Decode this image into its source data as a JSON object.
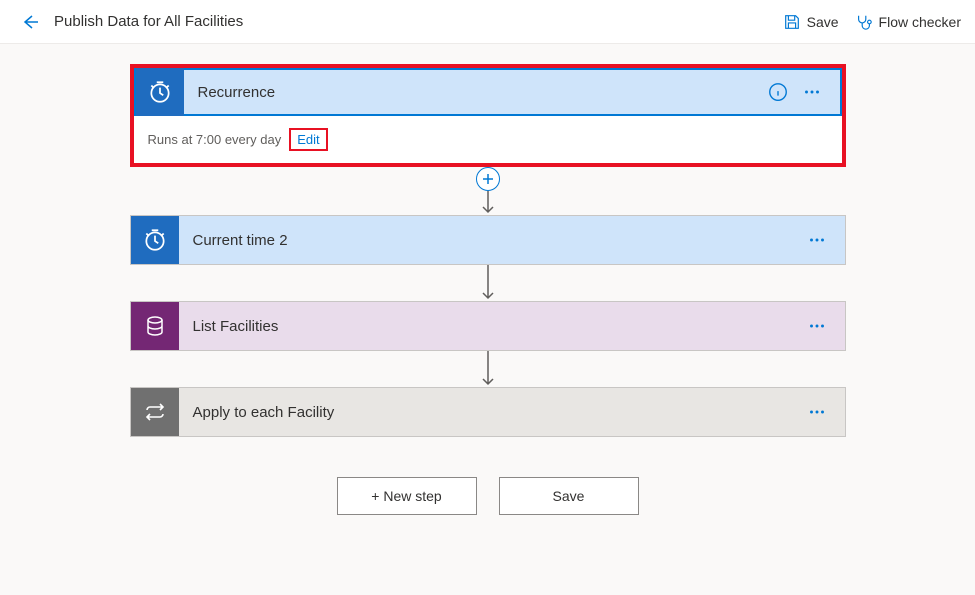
{
  "header": {
    "title": "Publish Data for All Facilities",
    "save_label": "Save",
    "flow_checker_label": "Flow checker"
  },
  "steps": {
    "recurrence": {
      "title": "Recurrence",
      "body_text": "Runs at 7:00 every day",
      "edit_label": "Edit"
    },
    "current_time": {
      "title": "Current time 2"
    },
    "list_facilities": {
      "title": "List Facilities"
    },
    "apply_each": {
      "title": "Apply to each Facility"
    }
  },
  "bottom": {
    "new_step_label": "+ New step",
    "save_label": "Save"
  }
}
